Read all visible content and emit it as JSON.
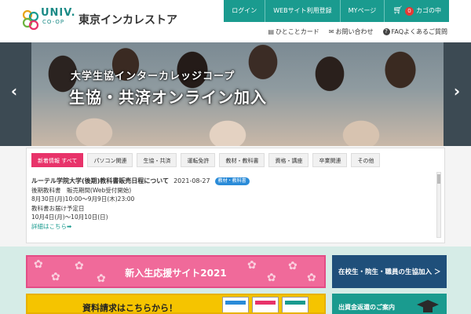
{
  "header": {
    "logo_main": "UNIV.",
    "logo_sub": "CO-OP",
    "store_name": "東京インカレストア",
    "top_nav": [
      "ログイン",
      "WEBサイト利用登録",
      "MYページ"
    ],
    "cart_label": "カゴの中",
    "cart_count": "0",
    "sub_nav": [
      {
        "icon": "id-card-icon",
        "glyph": "▤",
        "label": "ひとことカード"
      },
      {
        "icon": "mail-icon",
        "glyph": "✉",
        "label": "お問い合わせ"
      },
      {
        "icon": "question-icon",
        "glyph": "?",
        "label": "FAQよくあるご質問"
      }
    ],
    "colors": {
      "accent": "#1a9b8f"
    }
  },
  "hero": {
    "line1": "大学生協インターカレッジコープ",
    "line2": "生協・共済オンライン加入",
    "prev_arrow": "‹",
    "next_arrow": "›"
  },
  "news": {
    "tabs": [
      "新着情報 すべて",
      "パソコン関連",
      "生協・共済",
      "運転免許",
      "教材・教科書",
      "資格・講座",
      "卒業関連",
      "その他"
    ],
    "active_tab": 0,
    "item": {
      "title": "ルーテル学院大学(後期)教科書販売日程について",
      "date": "2021-08-27",
      "tag": "教材・教科書",
      "lines": [
        "後期教科書　販売期間(Web受付開始)",
        "8月30日(月)10:00～9月9日(木)23:00",
        "教科書お届け予定日",
        "10月4日(月)～10月10日(日)"
      ],
      "link": "詳細はこちら➡"
    },
    "colors": {
      "active_tab": "#e8336a",
      "tag": "#2a8bd8"
    }
  },
  "banners": {
    "new_students": "新入生応援サイト2021",
    "materials": "資料請求はこちらから！",
    "join_button": "在校生・院生・職員の生協加入 ＞",
    "refund_button": "出資金返還のご案内"
  }
}
